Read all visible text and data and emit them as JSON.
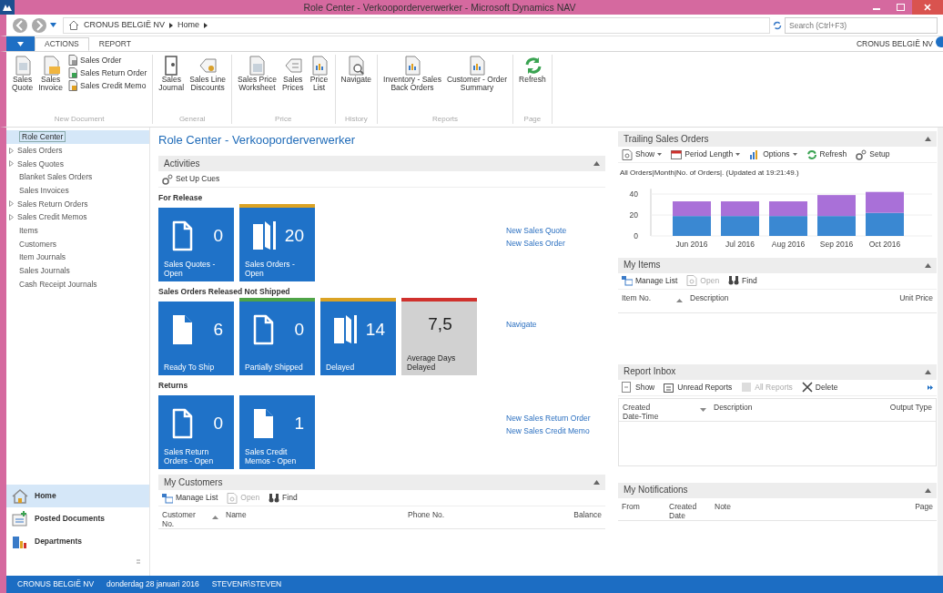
{
  "window": {
    "title": "Role Center - Verkooporderverwerker - Microsoft Dynamics NAV"
  },
  "address": {
    "breadcrumb": [
      "CRONUS BELGIË NV",
      "Home"
    ],
    "search": {
      "placeholder": "Search (Ctrl+F3)"
    }
  },
  "ribbon": {
    "tabs": [
      {
        "label": "ACTIONS",
        "selected": true
      },
      {
        "label": "REPORT",
        "selected": false
      }
    ],
    "company": "CRONUS BELGIË NV",
    "groups": [
      {
        "name": "New Document",
        "actions": [
          {
            "label": "Sales\nQuote",
            "kind": "large"
          },
          {
            "label": "Sales\nInvoice",
            "kind": "large"
          },
          {
            "label": "Sales Order",
            "kind": "small"
          },
          {
            "label": "Sales Return Order",
            "kind": "small"
          },
          {
            "label": "Sales Credit Memo",
            "kind": "small"
          }
        ]
      },
      {
        "name": "General",
        "actions": [
          {
            "label": "Sales\nJournal",
            "kind": "large"
          },
          {
            "label": "Sales Line\nDiscounts",
            "kind": "large"
          }
        ]
      },
      {
        "name": "Price",
        "actions": [
          {
            "label": "Sales Price\nWorksheet",
            "kind": "large"
          },
          {
            "label": "Sales\nPrices",
            "kind": "large"
          },
          {
            "label": "Price\nList",
            "kind": "large"
          }
        ]
      },
      {
        "name": "History",
        "actions": [
          {
            "label": "Navigate",
            "kind": "large"
          }
        ]
      },
      {
        "name": "Reports",
        "actions": [
          {
            "label": "Inventory - Sales\nBack Orders",
            "kind": "large"
          },
          {
            "label": "Customer - Order\nSummary",
            "kind": "large"
          }
        ]
      },
      {
        "name": "Page",
        "actions": [
          {
            "label": "Refresh",
            "kind": "large"
          }
        ]
      }
    ]
  },
  "sidebar": {
    "items": [
      {
        "label": "Role Center",
        "expandable": false,
        "selected": true
      },
      {
        "label": "Sales Orders",
        "expandable": true,
        "selected": false
      },
      {
        "label": "Sales Quotes",
        "expandable": true,
        "selected": false
      },
      {
        "label": "Blanket Sales Orders",
        "expandable": false,
        "selected": false
      },
      {
        "label": "Sales Invoices",
        "expandable": false,
        "selected": false
      },
      {
        "label": "Sales Return Orders",
        "expandable": true,
        "selected": false
      },
      {
        "label": "Sales Credit Memos",
        "expandable": true,
        "selected": false
      },
      {
        "label": "Items",
        "expandable": false,
        "selected": false
      },
      {
        "label": "Customers",
        "expandable": false,
        "selected": false
      },
      {
        "label": "Item Journals",
        "expandable": false,
        "selected": false
      },
      {
        "label": "Sales Journals",
        "expandable": false,
        "selected": false
      },
      {
        "label": "Cash Receipt Journals",
        "expandable": false,
        "selected": false
      }
    ],
    "departments": [
      {
        "label": "Home",
        "selected": true
      },
      {
        "label": "Posted Documents",
        "selected": false
      },
      {
        "label": "Departments",
        "selected": false
      }
    ]
  },
  "page_title": "Role Center - Verkooporderverwerker",
  "activities": {
    "title": "Activities",
    "toolbar": [
      "Set Up Cues"
    ],
    "groups": [
      {
        "title": "For Release",
        "cues": [
          {
            "value": "0",
            "label": "Sales Quotes -\nOpen",
            "kind": "outline"
          },
          {
            "value": "20",
            "label": "Sales Orders -\nOpen",
            "kind": "stack",
            "color": "#dba325"
          }
        ],
        "links": [
          "New Sales Quote",
          "New Sales Order"
        ]
      },
      {
        "title": "Sales Orders Released Not Shipped",
        "cues": [
          {
            "value": "6",
            "label": "Ready To Ship",
            "kind": "filled"
          },
          {
            "value": "0",
            "label": "Partially Shipped",
            "kind": "outline",
            "color": "#4fa447"
          },
          {
            "value": "14",
            "label": "Delayed",
            "kind": "stack",
            "color": "#dba325"
          },
          {
            "value": "7,5",
            "label": "Average Days\nDelayed",
            "kind": "plain",
            "color": "#d0312d"
          }
        ],
        "links": [
          "Navigate"
        ]
      },
      {
        "title": "Returns",
        "cues": [
          {
            "value": "0",
            "label": "Sales Return\nOrders - Open",
            "kind": "outline"
          },
          {
            "value": "1",
            "label": "Sales Credit\nMemos - Open",
            "kind": "filled"
          }
        ],
        "links": [
          "New Sales Return Order",
          "New Sales Credit Memo"
        ]
      }
    ]
  },
  "my_customers": {
    "title": "My Customers",
    "toolbar": [
      {
        "label": "Manage List",
        "disabled": false
      },
      {
        "label": "Open",
        "disabled": true
      },
      {
        "label": "Find",
        "disabled": false
      }
    ],
    "columns": [
      {
        "label": "Customer\nNo.",
        "sorted": true,
        "descending": false
      },
      {
        "label": "Name",
        "sorted": false
      },
      {
        "label": "Phone No.",
        "sorted": false
      },
      {
        "label": "Balance",
        "sorted": false
      }
    ]
  },
  "trailing_sales_orders": {
    "title": "Trailing Sales Orders",
    "toolbar": [
      {
        "label": "Show",
        "dropdown": true
      },
      {
        "label": "Period Length",
        "dropdown": true
      },
      {
        "label": "Options",
        "dropdown": true
      },
      {
        "label": "Refresh",
        "dropdown": false
      },
      {
        "label": "Setup",
        "dropdown": false
      }
    ],
    "subtitle": "All Orders|Month|No. of Orders|. (Updated at 19:21:49.)",
    "chart_data": {
      "type": "bar",
      "stacked": true,
      "categories": [
        "Jun 2016",
        "Jul 2016",
        "Aug 2016",
        "Sep 2016",
        "Oct 2016"
      ],
      "yticks": [
        0,
        20,
        40
      ],
      "ylim": [
        0,
        45
      ],
      "series": [
        {
          "color": "#3a88d2",
          "values": [
            19,
            19,
            19,
            19,
            22
          ]
        },
        {
          "color": "#a970d8",
          "values": [
            14,
            14,
            14,
            20,
            20
          ]
        }
      ]
    }
  },
  "my_items": {
    "title": "My Items",
    "toolbar": [
      {
        "label": "Manage List",
        "disabled": false
      },
      {
        "label": "Open",
        "disabled": true
      },
      {
        "label": "Find",
        "disabled": false
      }
    ],
    "columns": [
      {
        "label": "Item No.",
        "sorted": true,
        "descending": false
      },
      {
        "label": "Description",
        "sorted": false
      },
      {
        "label": "Unit Price",
        "sorted": false
      }
    ]
  },
  "report_inbox": {
    "title": "Report Inbox",
    "toolbar": [
      {
        "label": "Show",
        "disabled": false
      },
      {
        "label": "Unread Reports",
        "disabled": false
      },
      {
        "label": "All Reports",
        "disabled": true
      },
      {
        "label": "Delete",
        "disabled": false
      }
    ],
    "columns": [
      {
        "label": "Created\nDate-Time",
        "sorted": true,
        "descending": true
      },
      {
        "label": "Description",
        "sorted": false
      },
      {
        "label": "Output Type",
        "sorted": false
      }
    ]
  },
  "my_notifications": {
    "title": "My Notifications",
    "columns": [
      {
        "label": "From"
      },
      {
        "label": "Created\nDate"
      },
      {
        "label": "Note"
      },
      {
        "label": "Page"
      }
    ]
  },
  "status_bar": [
    "CRONUS BELGIË NV",
    "donderdag 28 januari 2016",
    "STEVENR\\STEVEN"
  ]
}
